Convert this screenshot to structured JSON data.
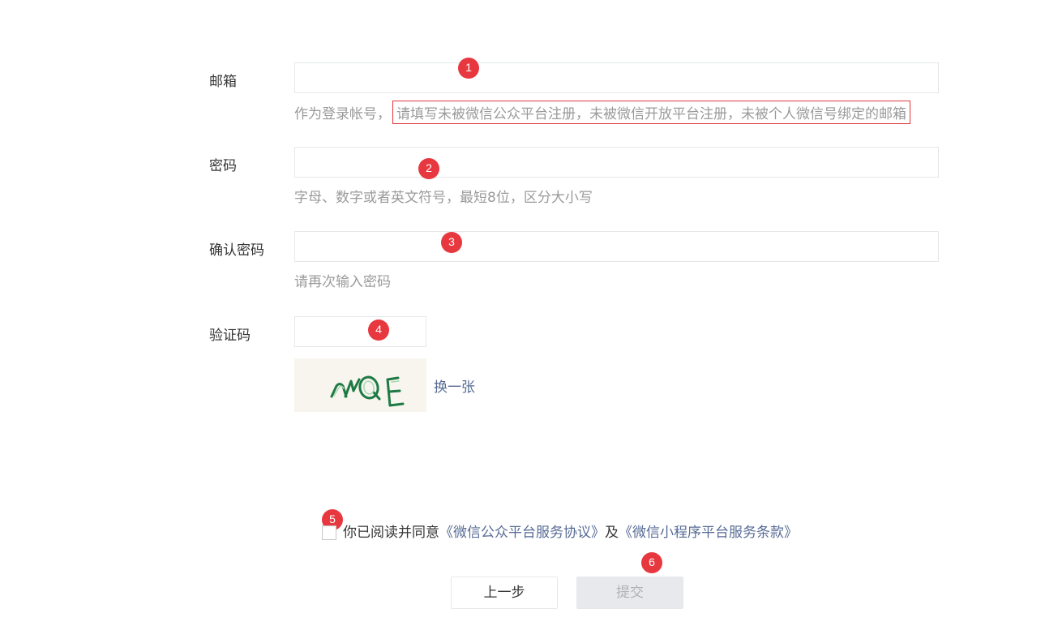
{
  "form": {
    "email": {
      "label": "邮箱",
      "value": "",
      "hint_prefix": "作为登录帐号，",
      "hint_highlight": "请填写未被微信公众平台注册，未被微信开放平台注册，未被个人微信号绑定的邮箱",
      "badge": "1"
    },
    "password": {
      "label": "密码",
      "value": "",
      "hint": "字母、数字或者英文符号，最短8位，区分大小写",
      "badge": "2"
    },
    "confirm_password": {
      "label": "确认密码",
      "value": "",
      "hint": "请再次输入密码",
      "badge": "3"
    },
    "captcha": {
      "label": "验证码",
      "value": "",
      "image_text": "nQE",
      "refresh_label": "换一张",
      "badge": "4"
    }
  },
  "agreement": {
    "badge": "5",
    "text_prefix": "你已阅读并同意",
    "link1": "《微信公众平台服务协议》",
    "conjunction": "及",
    "link2": "《微信小程序平台服务条款》",
    "checked": false
  },
  "actions": {
    "prev_label": "上一步",
    "submit_label": "提交",
    "submit_badge": "6"
  },
  "colors": {
    "badge": "#e8383f",
    "link": "#576b95",
    "highlight_border": "#e0383e",
    "captcha_ink": "#1e7a45"
  }
}
